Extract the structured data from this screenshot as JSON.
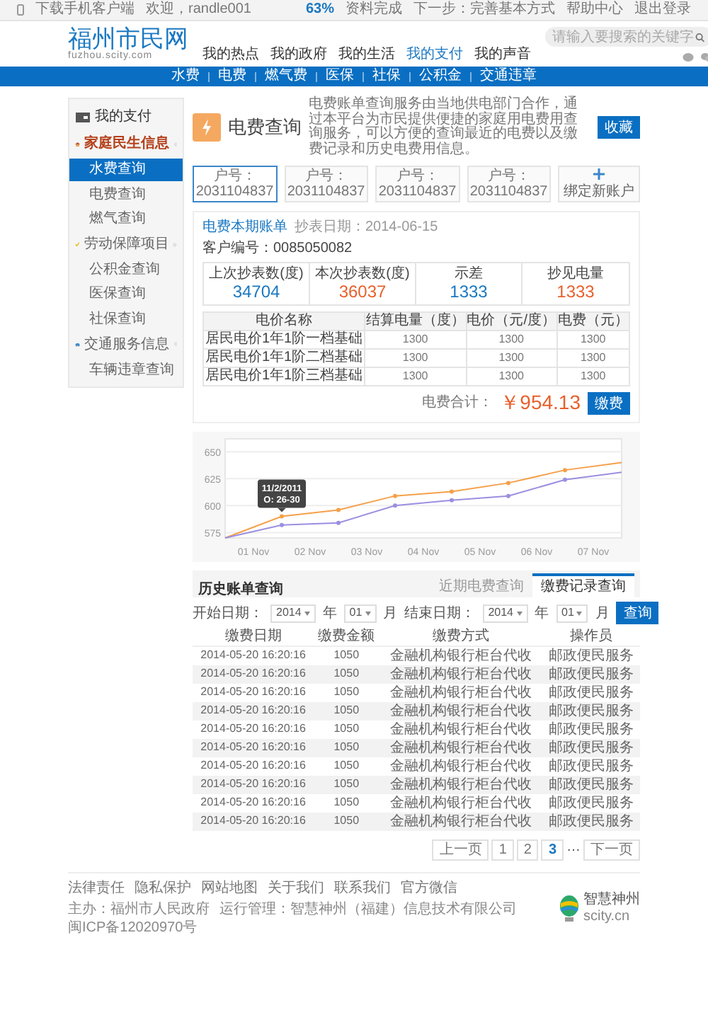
{
  "top_bar": {
    "app_link": "下载手机客户端",
    "user_menu": "欢迎，randle001",
    "progress": "63%",
    "progress_label": "资料完成",
    "links": [
      "下一步：完善基本方式",
      "帮助中心",
      "退出登录"
    ]
  },
  "header": {
    "logo": "福州市民网",
    "logo_sub": "fuzhou.scity.com",
    "nav": [
      {
        "label": "我的热点",
        "selected": false
      },
      {
        "label": "我的政府",
        "selected": false
      },
      {
        "label": "我的生活",
        "selected": false
      },
      {
        "label": "我的支付",
        "selected": true
      },
      {
        "label": "我的声音",
        "selected": false
      }
    ],
    "search": {
      "placeholder": "请输入要搜索的关键字"
    }
  },
  "sub_nav": [
    "水费",
    "电费",
    "燃气费",
    "医保",
    "社保",
    "公积金",
    "交通违章"
  ],
  "sidebar": {
    "title": "我的支付",
    "groups": [
      {
        "label": "家庭民生信息",
        "children": [
          {
            "label": "水费查询",
            "selected": true
          },
          {
            "label": "电费查询",
            "selected": false
          },
          {
            "label": "燃气查询",
            "selected": false
          }
        ]
      },
      {
        "label": "劳动保障项目",
        "children": [
          {
            "label": "公积金查询",
            "selected": false
          },
          {
            "label": "医保查询",
            "selected": false
          },
          {
            "label": "社保查询",
            "selected": false
          }
        ]
      },
      {
        "label": "交通服务信息",
        "children": [
          {
            "label": "车辆违章查询",
            "selected": false
          }
        ]
      }
    ]
  },
  "service": {
    "title": "电费查询",
    "description": "电费账单查询服务由当地供电部门合作，通过本平台为市民提供便捷的家庭用电费用查询服务，可以方便的查询最近的电费以及缴费记录和历史电费用信息。",
    "favorite_button": "收藏",
    "accounts": [
      {
        "label": "户号：2031104837",
        "selected": true
      },
      {
        "label": "户号：2031104837",
        "selected": false
      },
      {
        "label": "户号：2031104837",
        "selected": false
      },
      {
        "label": "户号：2031104837",
        "selected": false
      }
    ],
    "add_account": "绑定新账户"
  },
  "bill": {
    "title": "电费本期账单",
    "read_date": "抄表日期：2014-06-15",
    "customer_no": "客户编号：0085050082",
    "stats": [
      {
        "label": "上次抄表数(度)",
        "value": "34704",
        "color": "#1a78c2"
      },
      {
        "label": "本次抄表数(度)",
        "value": "36037",
        "color": "#e8602c"
      },
      {
        "label": "示差",
        "value": "1333",
        "color": "#1a78c2"
      },
      {
        "label": "抄见电量",
        "value": "1333",
        "color": "#e8602c"
      }
    ],
    "table": {
      "columns": [
        "电价名称",
        "结算电量（度）",
        "电价（元/度）",
        "电费（元）"
      ],
      "rows": [
        [
          "居民电价1年1阶一档基础",
          "1300",
          "1300",
          "1300"
        ],
        [
          "居民电价1年1阶二档基础",
          "1300",
          "1300",
          "1300"
        ],
        [
          "居民电价1年1阶三档基础",
          "1300",
          "1300",
          "1300"
        ]
      ]
    },
    "total_label": "电费合计：",
    "total": "￥954.13",
    "pay_button": "缴费"
  },
  "chart": {
    "chart_data": {
      "type": "line",
      "categories": [
        null,
        "01 Nov",
        null,
        "02 Nov",
        null,
        "03 Nov",
        null,
        "04 Nov",
        null,
        "05 Nov",
        null,
        "06 Nov",
        null,
        "07 Nov",
        null
      ],
      "ylim": [
        570,
        662
      ],
      "yticks": [
        575,
        600,
        625,
        650
      ],
      "series": [
        {
          "color": "#f5a04a",
          "values": [
            570,
            null,
            590,
            null,
            596,
            null,
            609,
            null,
            613,
            null,
            621,
            null,
            633,
            null,
            640
          ]
        },
        {
          "color": "#9b8fe0",
          "values": [
            570,
            null,
            582,
            null,
            584,
            null,
            600,
            null,
            605,
            null,
            609,
            null,
            624,
            null,
            631
          ]
        }
      ],
      "grid": true,
      "annotations": [
        {
          "text": "11/2/2011\nO: 26-30"
        }
      ]
    }
  },
  "history": {
    "title": "历史账单查询",
    "tabs": [
      {
        "label": "近期电费查询",
        "selected": false
      },
      {
        "label": "缴费记录查询",
        "selected": true
      }
    ],
    "filter": {
      "start_label": "开始日期：",
      "start_year": "2014",
      "year_unit": "年",
      "start_month": "01",
      "month_unit": "月",
      "end_label": "结束日期：",
      "end_year": "2014",
      "end_year_unit": "年",
      "end_month": "01",
      "end_month_unit": "月",
      "button": "查询"
    },
    "columns": [
      "缴费日期",
      "缴费金额",
      "缴费方式",
      "操作员"
    ],
    "rows": [
      [
        "2014-05-20 16:20:16",
        "1050",
        "金融机构银行柜台代收",
        "邮政便民服务"
      ],
      [
        "2014-05-20 16:20:16",
        "1050",
        "金融机构银行柜台代收",
        "邮政便民服务"
      ],
      [
        "2014-05-20 16:20:16",
        "1050",
        "金融机构银行柜台代收",
        "邮政便民服务"
      ],
      [
        "2014-05-20 16:20:16",
        "1050",
        "金融机构银行柜台代收",
        "邮政便民服务"
      ],
      [
        "2014-05-20 16:20:16",
        "1050",
        "金融机构银行柜台代收",
        "邮政便民服务"
      ],
      [
        "2014-05-20 16:20:16",
        "1050",
        "金融机构银行柜台代收",
        "邮政便民服务"
      ],
      [
        "2014-05-20 16:20:16",
        "1050",
        "金融机构银行柜台代收",
        "邮政便民服务"
      ],
      [
        "2014-05-20 16:20:16",
        "1050",
        "金融机构银行柜台代收",
        "邮政便民服务"
      ],
      [
        "2014-05-20 16:20:16",
        "1050",
        "金融机构银行柜台代收",
        "邮政便民服务"
      ],
      [
        "2014-05-20 16:20:16",
        "1050",
        "金融机构银行柜台代收",
        "邮政便民服务"
      ]
    ]
  },
  "pagination": {
    "prev": "上一页",
    "pages": [
      {
        "label": "1",
        "selected": false
      },
      {
        "label": "2",
        "selected": false
      },
      {
        "label": "3",
        "selected": true
      }
    ],
    "ellipsis": "…",
    "next": "下一页"
  },
  "footer": {
    "links": [
      "法律责任",
      "隐私保护",
      "网站地图",
      "关于我们",
      "联系我们",
      "官方微信"
    ],
    "info": [
      "主办：福州市人民政府",
      "运行管理：智慧神州（福建）信息技术有限公司",
      "闽ICP备12020970号"
    ],
    "logo": "智慧神州",
    "logo_sub": "scity.cn"
  }
}
